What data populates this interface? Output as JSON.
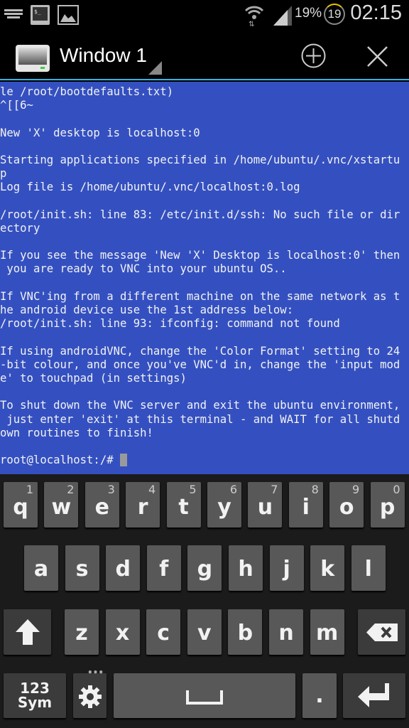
{
  "status_bar": {
    "battery": "19%",
    "notification_count": "19",
    "time": "02:15",
    "icons": [
      "keyboard-icon",
      "terminal-icon",
      "image-icon",
      "wifi-icon",
      "signal-icon"
    ]
  },
  "action_bar": {
    "title": "Window 1",
    "add_icon": "plus-circle-icon",
    "close_icon": "close-icon",
    "accent": "#33b5e5"
  },
  "terminal": {
    "background": "#3450c0",
    "lines": [
      "le /root/bootdefaults.txt)",
      "^[[6~",
      "",
      "New 'X' desktop is localhost:0",
      "",
      "Starting applications specified in /home/ubuntu/.vnc/xstartu",
      "p",
      "Log file is /home/ubuntu/.vnc/localhost:0.log",
      "",
      "/root/init.sh: line 83: /etc/init.d/ssh: No such file or dir",
      "ectory",
      "",
      "If you see the message 'New 'X' Desktop is localhost:0' then",
      " you are ready to VNC into your ubuntu OS..",
      "",
      "If VNC'ing from a different machine on the same network as t",
      "he android device use the 1st address below:",
      "/root/init.sh: line 93: ifconfig: command not found",
      "",
      "If using androidVNC, change the 'Color Format' setting to 24",
      "-bit colour, and once you've VNC'd in, change the 'input mod",
      "e' to touchpad (in settings)",
      "",
      "To shut down the VNC server and exit the ubuntu environment,",
      " just enter 'exit' at this terminal - and WAIT for all shutd",
      "own routines to finish!",
      ""
    ],
    "prompt": "root@localhost:/# "
  },
  "keyboard": {
    "row1": [
      [
        "q",
        "1"
      ],
      [
        "w",
        "2"
      ],
      [
        "e",
        "3"
      ],
      [
        "r",
        "4"
      ],
      [
        "t",
        "5"
      ],
      [
        "y",
        "6"
      ],
      [
        "u",
        "7"
      ],
      [
        "i",
        "8"
      ],
      [
        "o",
        "9"
      ],
      [
        "p",
        "0"
      ]
    ],
    "row2": [
      "a",
      "s",
      "d",
      "f",
      "g",
      "h",
      "j",
      "k",
      "l"
    ],
    "row3": [
      "z",
      "x",
      "c",
      "v",
      "b",
      "n",
      "m"
    ],
    "sym_label": "123\nSym",
    "period": "."
  }
}
